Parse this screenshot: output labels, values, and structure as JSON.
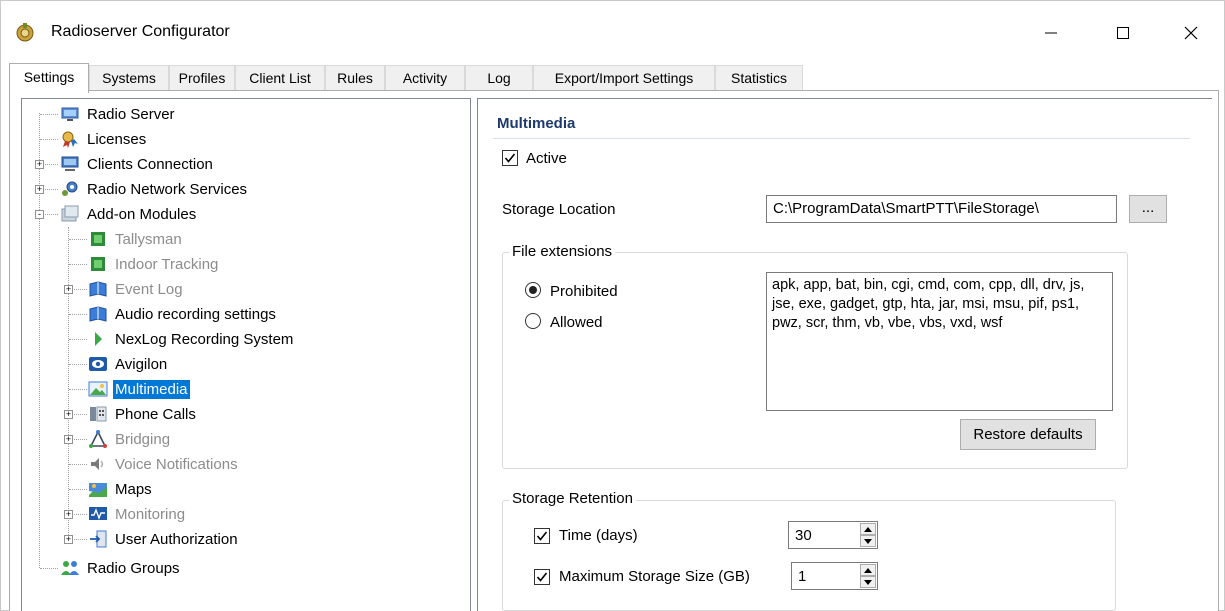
{
  "window": {
    "title": "Radioserver Configurator",
    "controls": [
      "minimize",
      "maximize",
      "close"
    ]
  },
  "tabs": [
    {
      "label": "Settings",
      "active": true
    },
    {
      "label": "Systems"
    },
    {
      "label": "Profiles"
    },
    {
      "label": "Client List"
    },
    {
      "label": "Rules"
    },
    {
      "label": "Activity"
    },
    {
      "label": "Log"
    },
    {
      "label": "Export/Import Settings"
    },
    {
      "label": "Statistics"
    }
  ],
  "tree": {
    "items": [
      {
        "label": "Radio Server",
        "icon": "server-icon"
      },
      {
        "label": "Licenses",
        "icon": "license-icon"
      },
      {
        "label": "Clients Connection",
        "icon": "network-icon",
        "expander": "+"
      },
      {
        "label": "Radio Network Services",
        "icon": "gear-network-icon",
        "expander": "+"
      },
      {
        "label": "Add-on Modules",
        "icon": "modules-icon",
        "expander": "-"
      },
      {
        "label": "Tallysman",
        "icon": "chip-icon",
        "disabled": true
      },
      {
        "label": "Indoor Tracking",
        "icon": "chip-icon",
        "disabled": true
      },
      {
        "label": "Event Log",
        "icon": "book-icon",
        "disabled": true,
        "expander": "+"
      },
      {
        "label": "Audio recording settings",
        "icon": "book-icon"
      },
      {
        "label": "NexLog Recording System",
        "icon": "nexlog-icon"
      },
      {
        "label": "Avigilon",
        "icon": "eye-icon"
      },
      {
        "label": "Multimedia",
        "icon": "image-icon",
        "selected": true
      },
      {
        "label": "Phone Calls",
        "icon": "phone-icon",
        "expander": "+"
      },
      {
        "label": "Bridging",
        "icon": "bridge-icon",
        "disabled": true,
        "expander": "+"
      },
      {
        "label": "Voice Notifications",
        "icon": "speaker-icon",
        "disabled": true
      },
      {
        "label": "Maps",
        "icon": "map-icon"
      },
      {
        "label": "Monitoring",
        "icon": "monitor-icon",
        "disabled": true,
        "expander": "+"
      },
      {
        "label": "User Authorization",
        "icon": "login-icon",
        "expander": "+"
      },
      {
        "label": "Radio Groups",
        "icon": "groups-icon"
      }
    ]
  },
  "multimedia": {
    "title": "Multimedia",
    "active_label": "Active",
    "active_checked": true,
    "storage_location_label": "Storage Location",
    "storage_location_value": "C:\\ProgramData\\SmartPTT\\FileStorage\\",
    "browse_label": "...",
    "file_extensions": {
      "title": "File extensions",
      "prohibited_label": "Prohibited",
      "allowed_label": "Allowed",
      "selected": "Prohibited",
      "extensions_text": "apk, app, bat, bin, cgi, cmd, com, cpp, dll, drv, js, jse, exe, gadget, gtp, hta, jar, msi, msu, pif, ps1, pwz, scr, thm, vb, vbe, vbs, vxd, wsf",
      "restore_label": "Restore defaults"
    },
    "retention": {
      "title": "Storage Retention",
      "time_label": "Time (days)",
      "time_checked": true,
      "time_value": "30",
      "size_label": "Maximum Storage Size (GB)",
      "size_checked": true,
      "size_value": "1"
    }
  },
  "colors": {
    "selection": "#0078d7",
    "section_title": "#1e3a6e",
    "disabled_text": "#8c8c8c"
  }
}
